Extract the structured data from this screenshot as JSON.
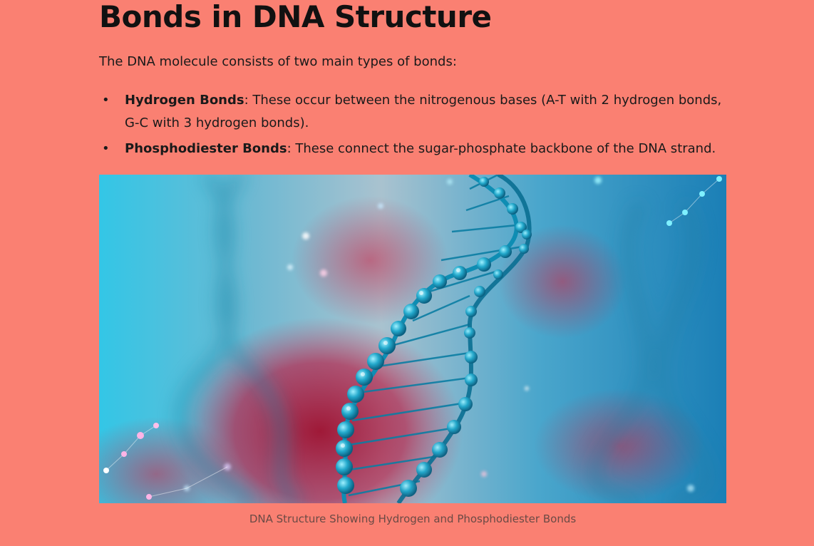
{
  "article": {
    "title": "Bonds in DNA Structure",
    "intro": "The DNA molecule consists of two main types of bonds:",
    "bonds": [
      {
        "name": "Hydrogen Bonds",
        "description": ": These occur between the nitrogenous bases (A-T with 2 hydrogen bonds, G-C with 3 hydrogen bonds)."
      },
      {
        "name": "Phosphodiester Bonds",
        "description": ": These connect the sugar-phosphate backbone of the DNA strand."
      }
    ],
    "bullet": "•",
    "caption": "DNA Structure Showing Hydrogen and Phosphodiester Bonds"
  },
  "colors": {
    "page_background": "#FA8072",
    "helix_blue": "#1fa3c4",
    "background_red": "#b0143a"
  }
}
